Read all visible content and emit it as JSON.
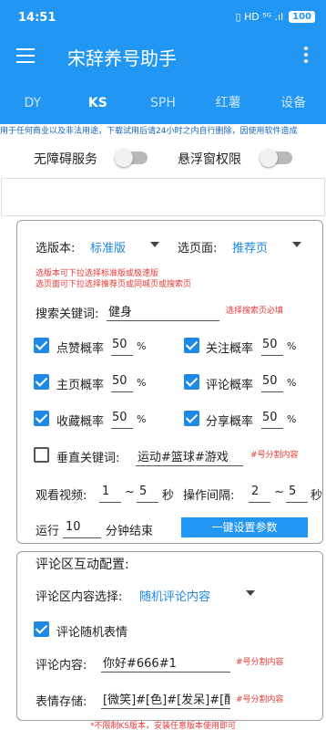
{
  "status_bar": {
    "time": "14:51",
    "signal_icons": "▯ HD ⁵ᴳ .ıl",
    "battery": "100"
  },
  "app": {
    "title": "宋辞养号助手"
  },
  "tabs": [
    {
      "label": "DY",
      "active": false
    },
    {
      "label": "KS",
      "active": true
    },
    {
      "label": "SPH",
      "active": false
    },
    {
      "label": "红薯",
      "active": false
    },
    {
      "label": "设备",
      "active": false
    }
  ],
  "notice": "用于任何商业以及非法用途，下载试用后请24小时之内自行删除，因使用软件造成",
  "permissions": {
    "accessibility_label": "无障碍服务",
    "accessibility_on": false,
    "overlay_label": "悬浮窗权限",
    "overlay_on": false
  },
  "settings": {
    "version_label": "选版本:",
    "version_value": "标准版",
    "page_label": "选页面:",
    "page_value": "推荐页",
    "note_line1": "选版本可下拉选择标准版或极速版",
    "note_line2": "选页面可下拉选择推荐页或同城页或搜索页",
    "keyword_label": "搜索关键词:",
    "keyword_value": "健身",
    "keyword_note": "选择搜索页必填",
    "probabilities": [
      {
        "label": "点赞概率",
        "value": "50",
        "unit": "%",
        "checked": true
      },
      {
        "label": "关注概率",
        "value": "50",
        "unit": "%",
        "checked": true
      },
      {
        "label": "主页概率",
        "value": "50",
        "unit": "%",
        "checked": true
      },
      {
        "label": "评论概率",
        "value": "50",
        "unit": "%",
        "checked": true
      },
      {
        "label": "收藏概率",
        "value": "50",
        "unit": "%",
        "checked": true
      },
      {
        "label": "分享概率",
        "value": "50",
        "unit": "%",
        "checked": true
      }
    ],
    "vertical_label": "垂直关键词:",
    "vertical_value": "运动#篮球#游戏",
    "vertical_checked": false,
    "vertical_note": "#号分割内容",
    "watch_label": "观看视频:",
    "watch_min": "1",
    "watch_sep": "~",
    "watch_max": "5",
    "watch_unit": "秒",
    "interval_label": "操作间隔:",
    "interval_min": "2",
    "interval_sep": "~",
    "interval_max": "5",
    "interval_unit": "秒",
    "run_label": "运行",
    "run_value": "10",
    "run_unit": "分钟结束",
    "setup_button": "一键设置参数"
  },
  "comments": {
    "title": "评论区互动配置:",
    "content_select_label": "评论区内容选择:",
    "content_select_value": "随机评论内容",
    "random_emoji_label": "评论随机表情",
    "random_emoji_checked": true,
    "content_label": "评论内容:",
    "content_value": "你好#666#1",
    "content_note": "#号分割内容",
    "emoji_label": "表情存储:",
    "emoji_value": "[微笑]#[色]#[发呆]#[酷",
    "emoji_note": "#号分割内容"
  },
  "footer_note": "*不限制KS版本，安装任意版本使用即可"
}
